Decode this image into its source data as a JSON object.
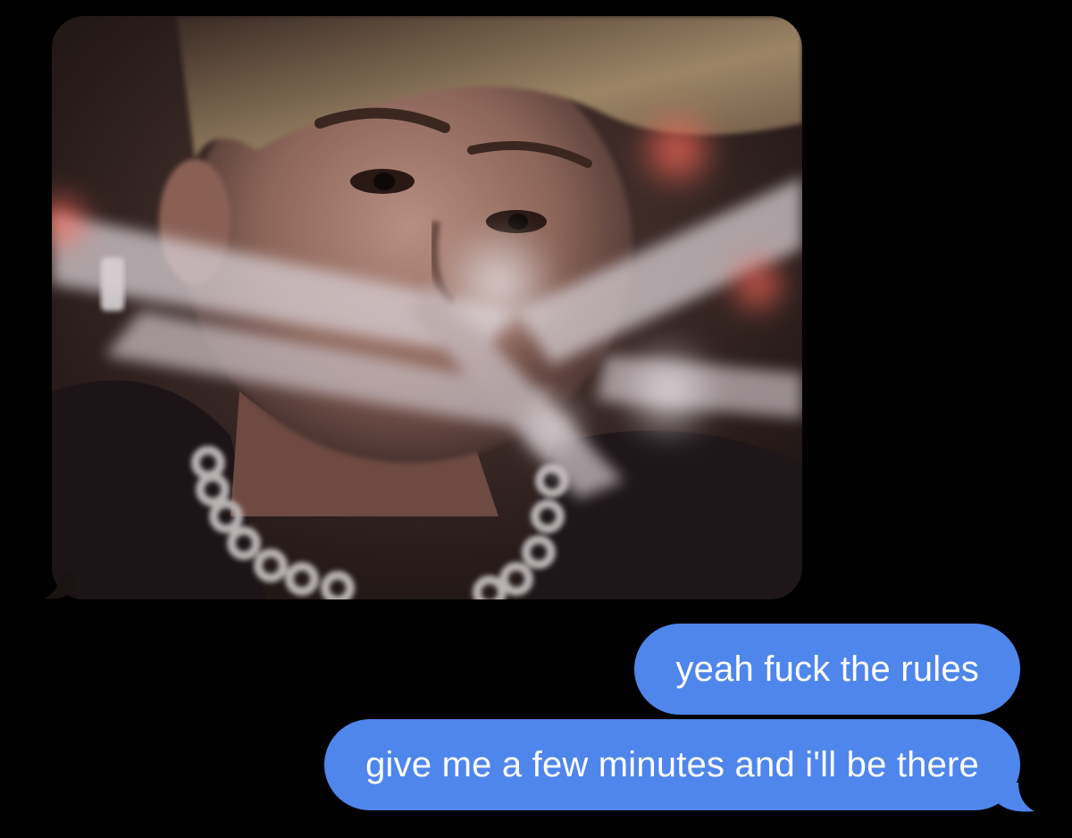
{
  "conversation": {
    "received_image": {
      "icon": "photo-attachment"
    },
    "sent_messages": [
      {
        "text": "yeah fuck the rules"
      },
      {
        "text": "give me a few minutes and i'll be there"
      }
    ]
  },
  "colors": {
    "background": "#000000",
    "sent_bubble": "#4f86ec",
    "sent_text": "#ffffff",
    "incoming_bubble": "#1a1312"
  }
}
